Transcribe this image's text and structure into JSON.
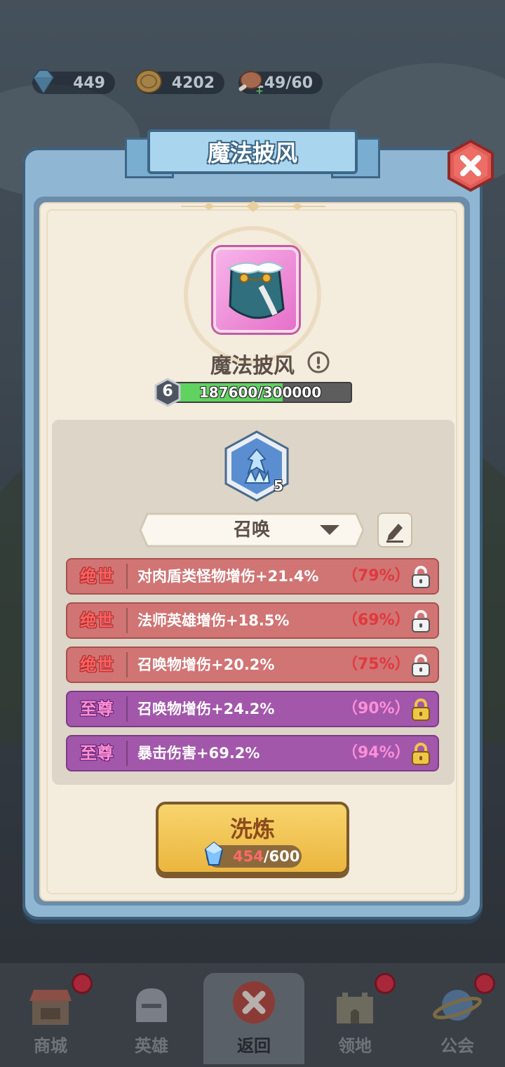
{
  "resources": {
    "diamonds": "449",
    "coins": "4202",
    "stamina": "149/60"
  },
  "modal": {
    "title": "魔法披风"
  },
  "item": {
    "name": "魔法披风",
    "level": "6",
    "exp_text": "187600/300000",
    "exp_progress": 0.625
  },
  "rune": {
    "level": "5"
  },
  "preset": {
    "selected": "召唤"
  },
  "attributes": [
    {
      "grade": "绝世",
      "text": "对肉盾类怪物增伤+21.4%",
      "percent": "（79%）",
      "tier": "red",
      "locked": false
    },
    {
      "grade": "绝世",
      "text": "法师英雄增伤+18.5%",
      "percent": "（69%）",
      "tier": "red",
      "locked": false
    },
    {
      "grade": "绝世",
      "text": "召唤物增伤+20.2%",
      "percent": "（75%）",
      "tier": "red",
      "locked": false
    },
    {
      "grade": "至尊",
      "text": "召唤物增伤+24.2%",
      "percent": "（90%）",
      "tier": "purple",
      "locked": true
    },
    {
      "grade": "至尊",
      "text": "暴击伤害+69.2%",
      "percent": "（94%）",
      "tier": "purple",
      "locked": true
    }
  ],
  "refine": {
    "label": "洗炼",
    "cost_current": "454",
    "cost_max": "/600"
  },
  "nav": [
    {
      "label": "商城",
      "badge": true
    },
    {
      "label": "英雄",
      "badge": false
    },
    {
      "label": "返回",
      "badge": false
    },
    {
      "label": "领地",
      "badge": true
    },
    {
      "label": "公会",
      "badge": true
    }
  ],
  "colors": {
    "red_row": "#d17474",
    "purple_row": "#a257ab",
    "exp_fill": "#5fd260",
    "refine_button": "#f2c453"
  }
}
